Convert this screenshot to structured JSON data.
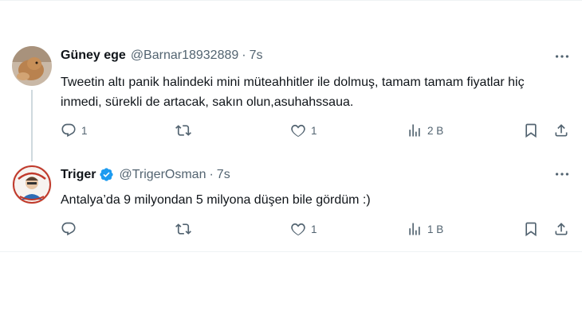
{
  "tweets": [
    {
      "name": "Güney ege",
      "handle": "@Barnar18932889",
      "time": "7s",
      "text": "Tweetin altı panik halindeki mini müteahhitler ile dolmuş,  tamam tamam fiyatlar hiç inmedi, sürekli de artacak, sakın olun,asuhahssaua.",
      "replies": "1",
      "retweets": "",
      "likes": "1",
      "views": "2 B",
      "verified": false
    },
    {
      "name": "Triger",
      "handle": "@TrigerOsman",
      "time": "7s",
      "text": "Antalya’da 9 milyondan 5 milyona düşen bile gördüm :)",
      "replies": "",
      "retweets": "",
      "likes": "1",
      "views": "1 B",
      "verified": true
    }
  ],
  "separator": "·",
  "icons": [
    "more-icon",
    "reply-icon",
    "retweet-icon",
    "like-icon",
    "views-icon",
    "bookmark-icon",
    "share-icon",
    "verified-badge-icon"
  ],
  "colors": {
    "text": "#0f1419",
    "secondary": "#536471",
    "verified": "#1d9bf0",
    "thread_line": "#cfd9de"
  }
}
